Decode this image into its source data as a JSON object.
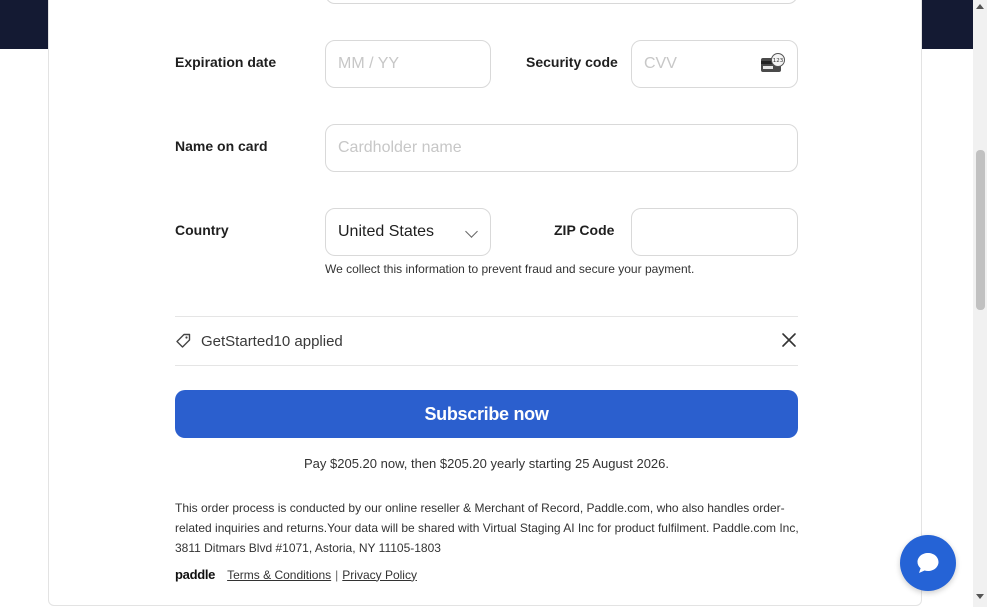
{
  "form": {
    "expiration_label": "Expiration date",
    "expiration_placeholder": "MM / YY",
    "security_label": "Security code",
    "security_placeholder": "CVV",
    "name_label": "Name on card",
    "name_placeholder": "Cardholder name",
    "country_label": "Country",
    "country_value": "United States",
    "zip_label": "ZIP Code",
    "zip_value": "",
    "note": "We collect this information to prevent fraud and secure your payment."
  },
  "coupon": {
    "text": "GetStarted10 applied",
    "icon": "tag-icon",
    "remove_icon": "close-icon"
  },
  "subscribe": {
    "label": "Subscribe now",
    "color": "#2b5fce"
  },
  "pay_text": "Pay $205.20 now, then $205.20 yearly starting 25 August 2026.",
  "legal": "This order process is conducted by our online reseller & Merchant of Record, Paddle.com, who also handles order-related inquiries and returns.Your data will be shared with Virtual Staging AI Inc for product fulfilment. Paddle.com Inc, 3811 Ditmars Blvd #1071, Astoria, NY 11105-1803",
  "footer": {
    "logo": "paddle",
    "terms": "Terms & Conditions",
    "separator": "|",
    "privacy": "Privacy Policy"
  },
  "chat": {
    "icon": "chat-bubble-icon",
    "color": "#2563d6"
  }
}
